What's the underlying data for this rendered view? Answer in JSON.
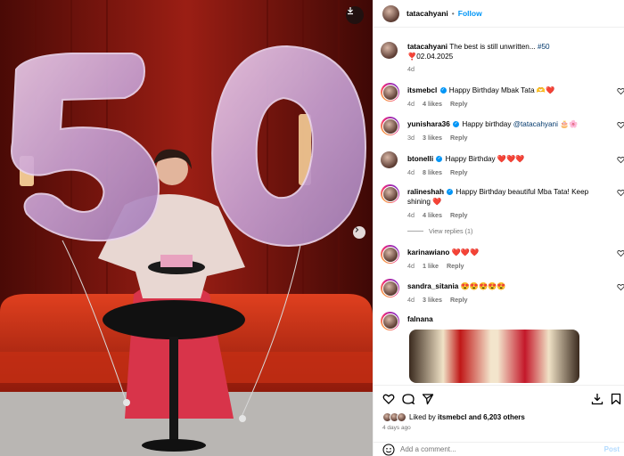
{
  "post": {
    "username": "tatacahyani",
    "follow_label": "Follow",
    "caption_text": "The best is still unwritten...",
    "caption_tag": "#50",
    "caption_date": "❣️02.04.2025",
    "caption_age": "4d"
  },
  "comments": [
    {
      "user": "itsmebcl",
      "verified": true,
      "text": "Happy Birthday Mbak Tata 🫶❤️",
      "age": "4d",
      "likes": "4 likes",
      "reply": "Reply"
    },
    {
      "user": "yunishara36",
      "verified": true,
      "text_before": "Happy birthday",
      "mention": "@tatacahyani",
      "text_after": "🎂🌸",
      "age": "3d",
      "likes": "3 likes",
      "reply": "Reply"
    },
    {
      "user": "btonelli",
      "verified": true,
      "text": "Happy Birthday ❤️❤️❤️",
      "age": "4d",
      "likes": "8 likes",
      "reply": "Reply"
    },
    {
      "user": "ralineshah",
      "verified": true,
      "text": "Happy Birthday beautiful Mba Tata! Keep shining ❤️",
      "age": "4d",
      "likes": "4 likes",
      "reply": "Reply",
      "view_replies": "View replies (1)"
    },
    {
      "user": "karinawiano",
      "verified": false,
      "text": "❤️❤️❤️",
      "age": "4d",
      "likes": "1 like",
      "reply": "Reply"
    },
    {
      "user": "sandra_sitania",
      "verified": false,
      "text": "😍😍😍😍😍",
      "age": "4d",
      "likes": "3 likes",
      "reply": "Reply"
    },
    {
      "user": "falnana",
      "verified": false,
      "text": ""
    }
  ],
  "footer": {
    "liked_by_prefix": "Liked by",
    "liked_by_user": "itsmebcl",
    "liked_by_suffix": "and 6,203 others",
    "time_ago": "4 days ago",
    "add_comment_placeholder": "Add a comment...",
    "post_label": "Post"
  },
  "colors": {
    "link": "#0095f6",
    "muted": "#737373",
    "like_red": "#ed4956"
  },
  "icons": [
    "download-icon",
    "chevron-right-icon",
    "heart-icon",
    "comment-icon",
    "share-icon",
    "save-icon",
    "bookmark-icon",
    "emoji-icon"
  ]
}
